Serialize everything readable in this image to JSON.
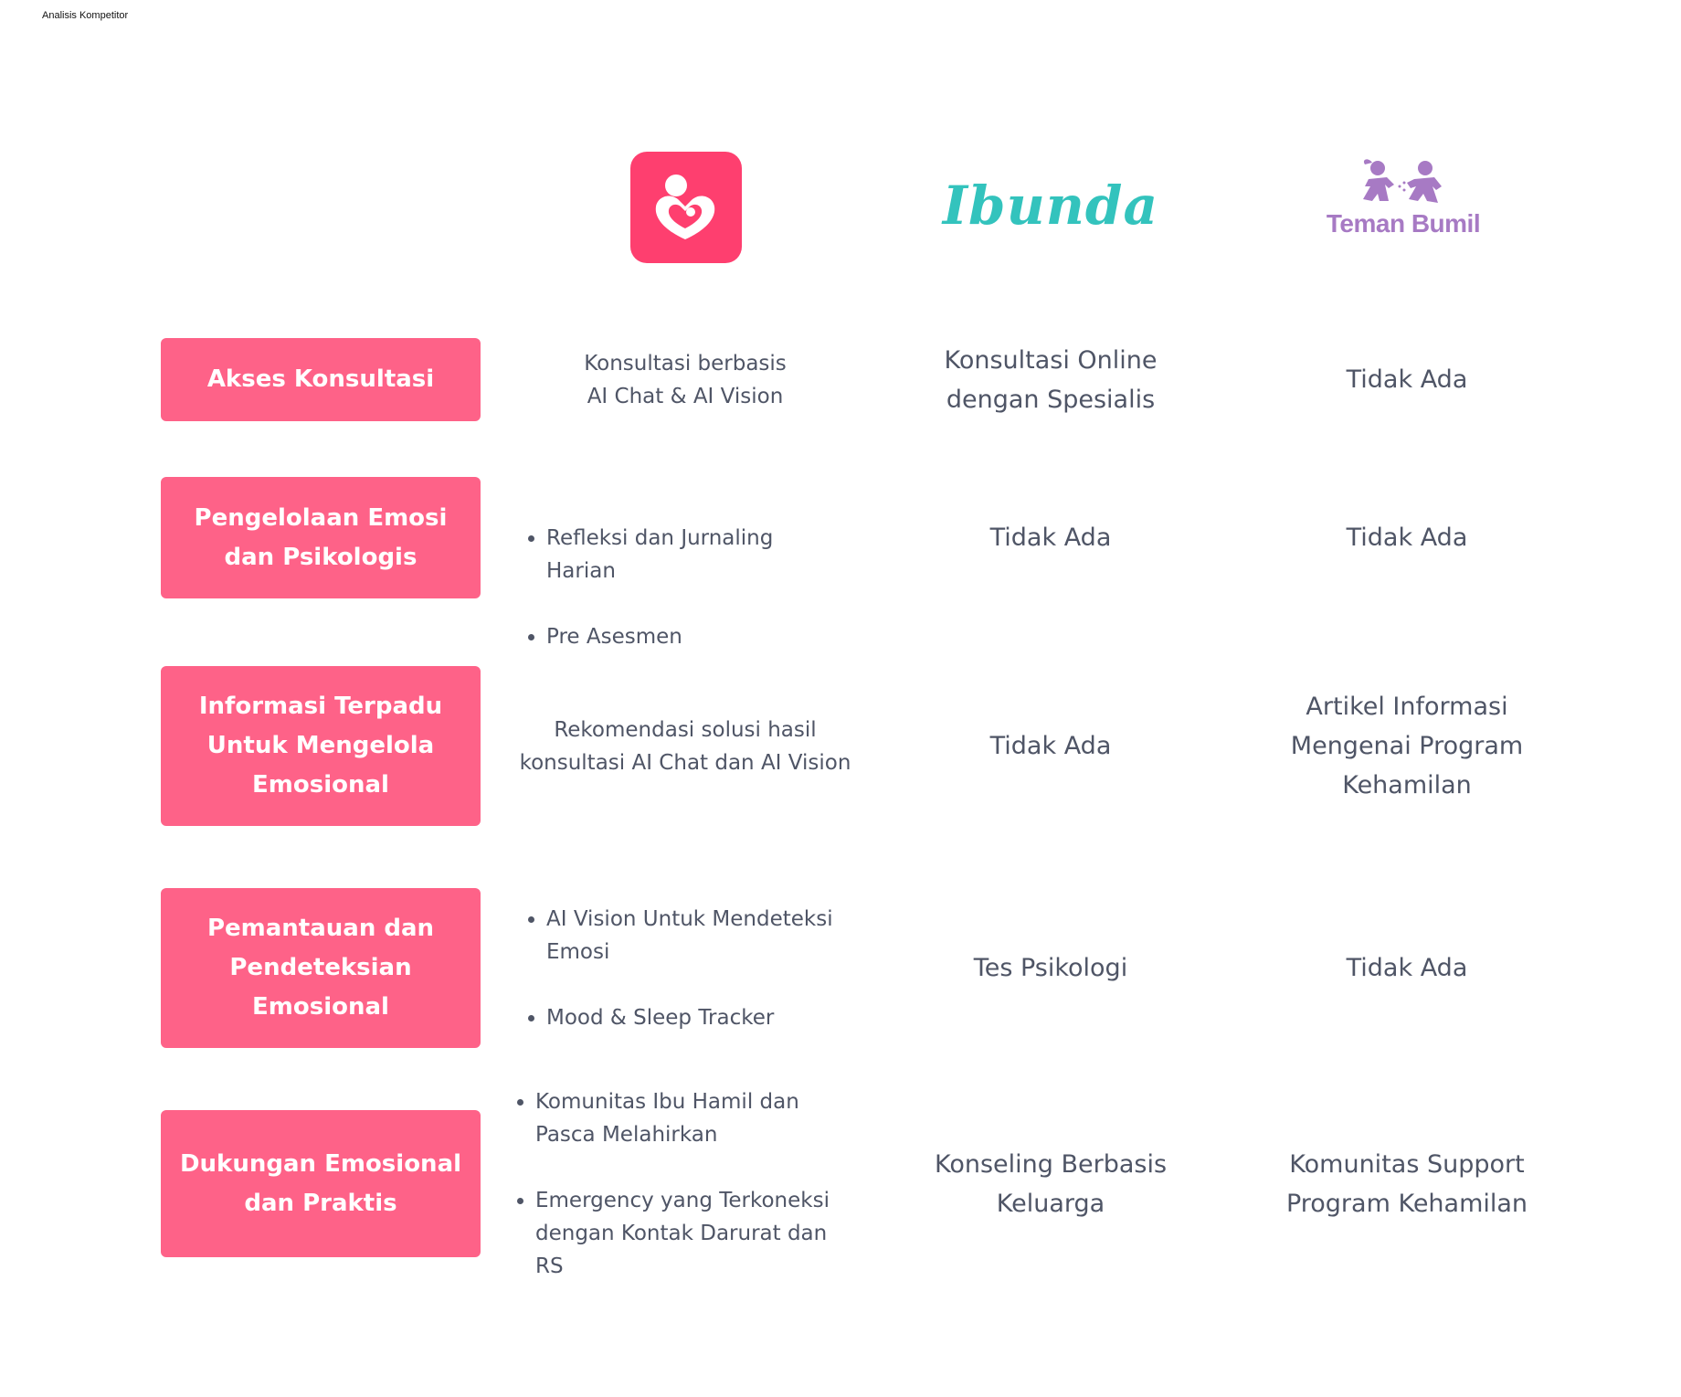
{
  "page": {
    "frame_title": "Analisis Kompetitor"
  },
  "brands": {
    "app": {
      "icon": "mother-heart-app-icon",
      "color": "#fe3f6f"
    },
    "ibunda": {
      "name": "Ibunda",
      "color": "#33c3bd"
    },
    "teman_bumil": {
      "name": "Teman Bumil",
      "color": "#a77ac4"
    }
  },
  "colors": {
    "feature_box": "#fe6288",
    "body_text": "#4f5566"
  },
  "rows": [
    {
      "feature": "Akses Konsultasi",
      "app": {
        "text": "Konsultasi berbasis\nAI Chat & AI Vision"
      },
      "ibunda": "Konsultasi Online\ndengan Spesialis",
      "teman_bumil": "Tidak Ada"
    },
    {
      "feature": "Pengelolaan Emosi\ndan Psikologis",
      "app": {
        "bullets": [
          "Refleksi dan Jurnaling Harian",
          "Pre Asesmen"
        ]
      },
      "ibunda": "Tidak Ada",
      "teman_bumil": "Tidak Ada"
    },
    {
      "feature": "Informasi Terpadu\nUntuk Mengelola\nEmosional",
      "app": {
        "text": "Rekomendasi solusi hasil\nkonsultasi AI Chat dan AI Vision"
      },
      "ibunda": "Tidak Ada",
      "teman_bumil": "Artikel Informasi\nMengenai Program\nKehamilan"
    },
    {
      "feature": "Pemantauan dan\nPendeteksian\nEmosional",
      "app": {
        "bullets": [
          "AI Vision Untuk Mendeteksi Emosi",
          "Mood & Sleep Tracker"
        ]
      },
      "ibunda": "Tes Psikologi",
      "teman_bumil": "Tidak Ada"
    },
    {
      "feature": "Dukungan Emosional\ndan Praktis",
      "app": {
        "bullets": [
          "Komunitas Ibu Hamil dan Pasca Melahirkan",
          "Emergency yang Terkoneksi dengan Kontak Darurat dan RS"
        ]
      },
      "ibunda": "Konseling Berbasis\nKeluarga",
      "teman_bumil": "Komunitas Support\nProgram Kehamilan"
    }
  ]
}
